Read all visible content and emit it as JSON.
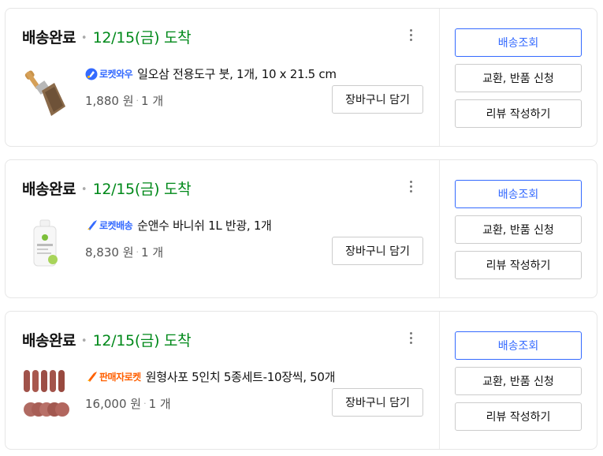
{
  "orders": [
    {
      "status": "배송완료",
      "arrival": "12/15(금) 도착",
      "badge": {
        "label": "로켓와우",
        "color": "#346aff",
        "icon": "rocket-wow-icon"
      },
      "product_name": "일오삼 전용도구 붓, 1개, 10 x 21.5 cm",
      "price": "1,880 원",
      "quantity": "1 개",
      "thumbnail": "paint-brush-thumbnail",
      "cart_label": "장바구니 담기",
      "actions": [
        "배송조회",
        "교환, 반품 신청",
        "리뷰 작성하기"
      ]
    },
    {
      "status": "배송완료",
      "arrival": "12/15(금) 도착",
      "badge": {
        "label": "로켓배송",
        "color": "#346aff",
        "icon": "rocket-icon"
      },
      "product_name": "순앤수 바니쉬 1L 반광, 1개",
      "price": "8,830 원",
      "quantity": "1 개",
      "thumbnail": "varnish-bottle-thumbnail",
      "cart_label": "장바구니 담기",
      "actions": [
        "배송조회",
        "교환, 반품 신청",
        "리뷰 작성하기"
      ]
    },
    {
      "status": "배송완료",
      "arrival": "12/15(금) 도착",
      "badge": {
        "label": "판매자로켓",
        "color": "#ff5f00",
        "icon": "rocket-seller-icon"
      },
      "product_name": "원형사포 5인치 5종세트-10장씩, 50개",
      "price": "16,000 원",
      "quantity": "1 개",
      "thumbnail": "sandpaper-discs-thumbnail",
      "cart_label": "장바구니 담기",
      "actions": [
        "배송조회",
        "교환, 반품 신청",
        "리뷰 작성하기"
      ]
    }
  ],
  "colors": {
    "arrival": "#00891a",
    "primary": "#346aff",
    "seller_rocket": "#ff5f00"
  }
}
